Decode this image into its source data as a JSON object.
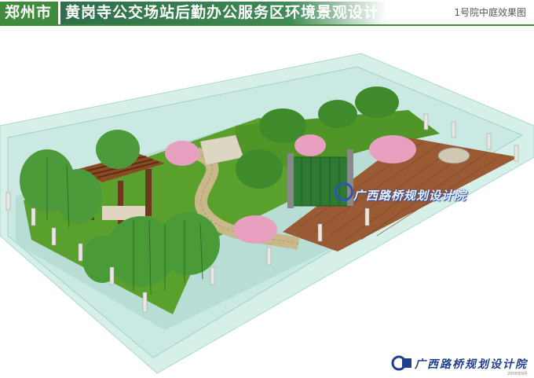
{
  "header": {
    "title_part1": "郑州市",
    "title_part2": "黄岗寺公交场站后勤办公服务区环境景观设计",
    "subtitle": "1号院中庭效果图"
  },
  "watermark": {
    "text": "广西路桥规划设计院"
  },
  "footer": {
    "logo_text": "广西路桥规划设计院",
    "small_text": "2009年8月"
  },
  "colors": {
    "header_green": "#3f8a3c",
    "glass": "#bfe8e2",
    "lawn": "#5aa02c",
    "deck": "#9a5a34",
    "path": "#c9b98a",
    "logo_blue": "#1e3f8c"
  }
}
